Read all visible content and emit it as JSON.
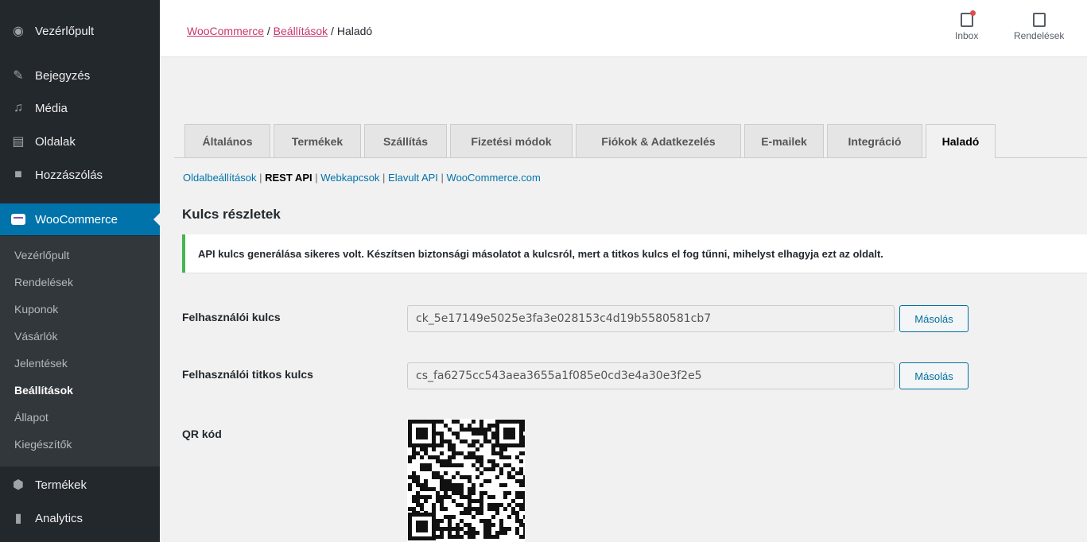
{
  "sidebar": {
    "menu": [
      {
        "label": "Vezérlőpult",
        "icon": "dashboard-icon"
      },
      {
        "label": "Bejegyzés",
        "icon": "pin-icon"
      },
      {
        "label": "Média",
        "icon": "media-icon"
      },
      {
        "label": "Oldalak",
        "icon": "pages-icon"
      },
      {
        "label": "Hozzászólás",
        "icon": "comments-icon"
      },
      {
        "label": "WooCommerce",
        "icon": "woocommerce-icon"
      }
    ],
    "submenu": [
      "Vezérlőpult",
      "Rendelések",
      "Kuponok",
      "Vásárlók",
      "Jelentések",
      "Beállítások",
      "Állapot",
      "Kiegészítők"
    ],
    "bottom_menu": [
      {
        "label": "Termékek",
        "icon": "products-icon"
      },
      {
        "label": "Analytics",
        "icon": "analytics-icon"
      }
    ]
  },
  "topbar": {
    "breadcrumb": {
      "woocommerce": "WooCommerce",
      "settings": "Beállítások",
      "current": "Haladó",
      "sep": "/"
    },
    "inbox": "Inbox",
    "orders": "Rendelések"
  },
  "tabs": [
    "Általános",
    "Termékek",
    "Szállítás",
    "Fizetési módok",
    "Fiókok & Adatkezelés",
    "E-mailek",
    "Integráció",
    "Haladó"
  ],
  "subsub": [
    "Oldalbeállítások",
    "REST API",
    "Webkapcsok",
    "Elavult API",
    "WooCommerce.com"
  ],
  "section_title": "Kulcs részletek",
  "notice": "API kulcs generálása sikeres volt. Készítsen biztonsági másolatot a kulcsról, mert a titkos kulcs el fog tűnni, mihelyst elhagyja ezt az oldalt.",
  "consumer_key": {
    "label": "Felhasználói kulcs",
    "value": "ck_5e17149e5025e3fa3e028153c4d19b5580581cb7",
    "button": "Másolás"
  },
  "consumer_secret": {
    "label": "Felhasználói titkos kulcs",
    "value": "cs_fa6275cc543aea3655a1f085e0cd3e4a30e3f2e5",
    "button": "Másolás"
  },
  "qr": {
    "label": "QR kód"
  },
  "colors": {
    "sidebar": "#23282d",
    "active": "#0073aa",
    "link": "#c9356e",
    "success": "#46b450"
  }
}
